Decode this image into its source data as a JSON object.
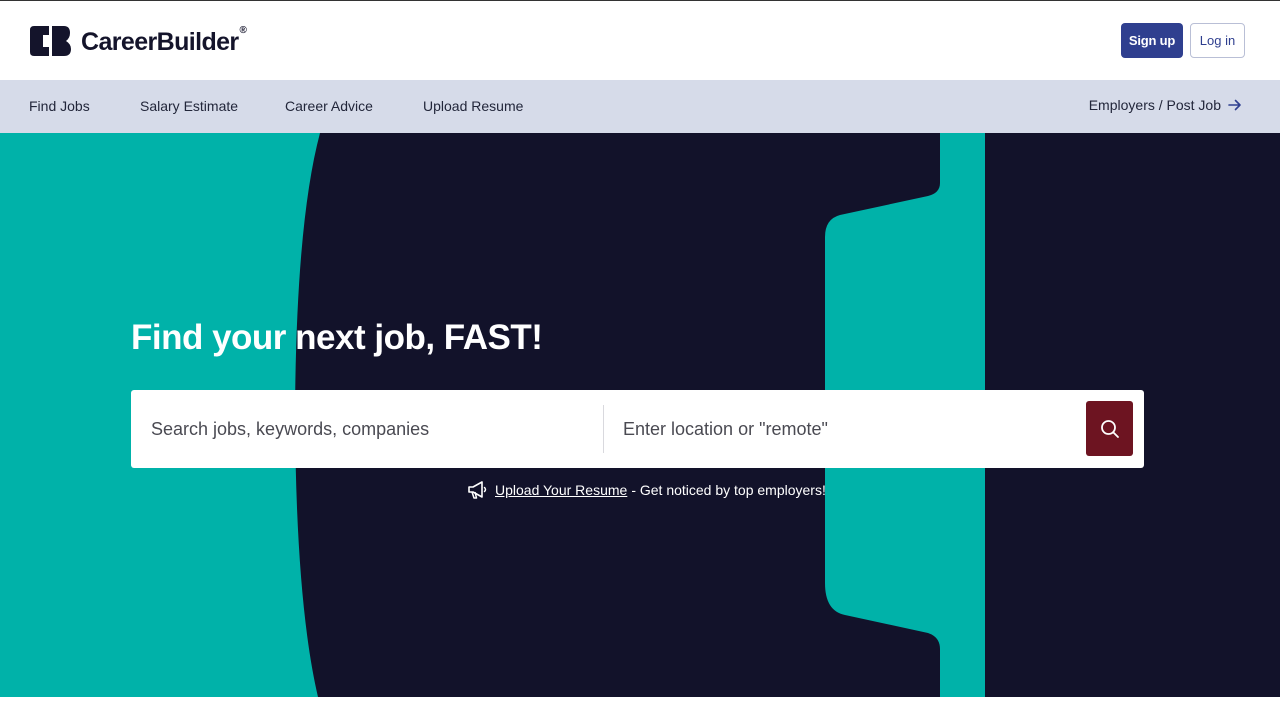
{
  "brand": {
    "name": "CareerBuilder",
    "registered_mark": "®"
  },
  "header": {
    "signup_label": "Sign up",
    "login_label": "Log in"
  },
  "nav": {
    "items": [
      {
        "label": "Find Jobs"
      },
      {
        "label": "Salary Estimate"
      },
      {
        "label": "Career Advice"
      },
      {
        "label": "Upload Resume"
      }
    ],
    "employers_label": "Employers / Post Job",
    "employers_icon": "arrow-right-icon"
  },
  "hero": {
    "title": "Find your next job, FAST!",
    "search": {
      "keywords_placeholder": "Search jobs, keywords, companies",
      "location_placeholder": "Enter location or \"remote\"",
      "button_icon": "search-icon"
    },
    "upload": {
      "icon": "megaphone-icon",
      "link_text": "Upload Your Resume",
      "tail_text": "- Get noticed by top employers!"
    }
  },
  "colors": {
    "brand_navy": "#14142b",
    "hero_teal": "#00b2a9",
    "hero_dark": "#12122a",
    "nav_background": "#d6dbe9",
    "signup_button": "#2f3f8f",
    "search_button": "#6d1421"
  }
}
